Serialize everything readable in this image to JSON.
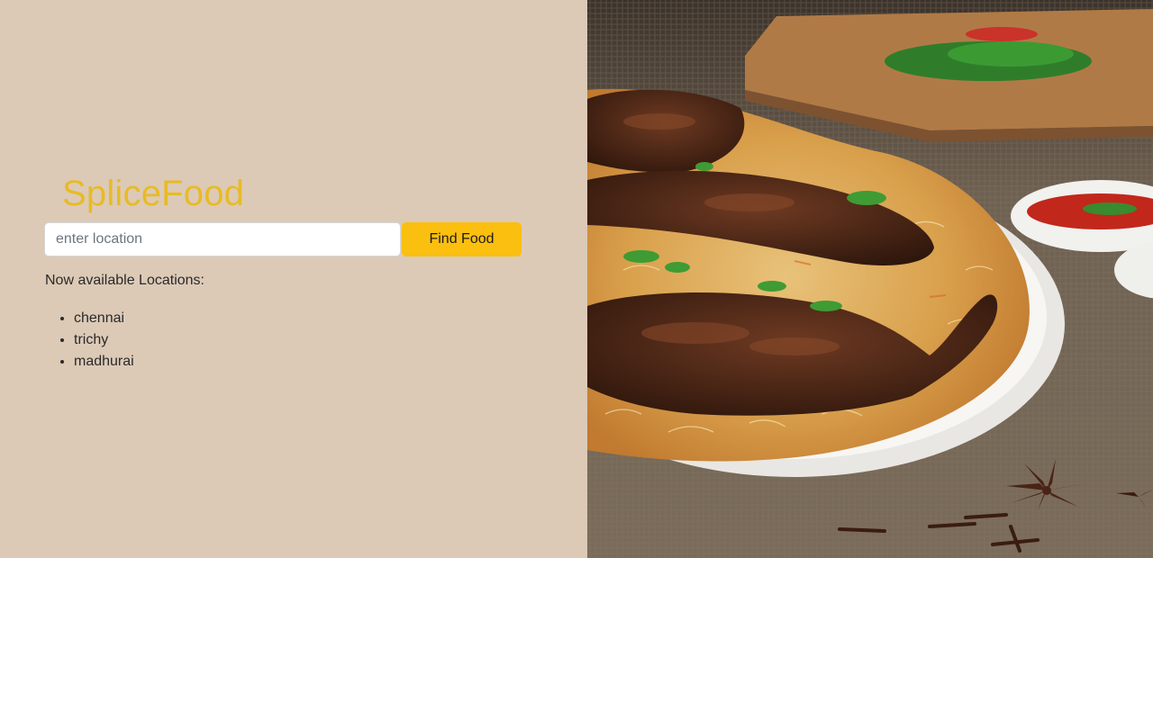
{
  "brand": {
    "name": "SpliceFood"
  },
  "search": {
    "placeholder": "enter location",
    "value": "",
    "button_label": "Find Food"
  },
  "locations": {
    "heading": "Now available Locations:",
    "items": [
      "chennai",
      "trichy",
      "madhurai"
    ]
  },
  "hero_image": {
    "subject": "biryani-plate-photo"
  },
  "colors": {
    "left_panel_bg": "#dccab7",
    "brand": "#e8bb24",
    "button_bg": "#fbbf0f"
  }
}
